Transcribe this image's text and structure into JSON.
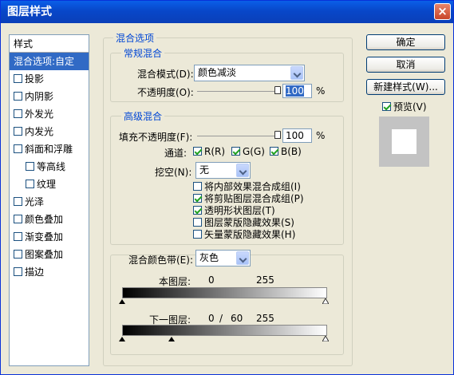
{
  "window": {
    "title": "图层样式",
    "close_glyph": "×"
  },
  "styles": {
    "header": "样式",
    "items": [
      {
        "label": "混合选项:自定",
        "checkbox": false,
        "selected": true
      },
      {
        "label": "投影",
        "checkbox": true
      },
      {
        "label": "内阴影",
        "checkbox": true
      },
      {
        "label": "外发光",
        "checkbox": true
      },
      {
        "label": "内发光",
        "checkbox": true
      },
      {
        "label": "斜面和浮雕",
        "checkbox": true
      },
      {
        "label": "等高线",
        "checkbox": true,
        "sub": true
      },
      {
        "label": "纹理",
        "checkbox": true,
        "sub": true
      },
      {
        "label": "光泽",
        "checkbox": true
      },
      {
        "label": "颜色叠加",
        "checkbox": true
      },
      {
        "label": "渐变叠加",
        "checkbox": true
      },
      {
        "label": "图案叠加",
        "checkbox": true
      },
      {
        "label": "描边",
        "checkbox": true
      }
    ]
  },
  "blend_options": {
    "title": "混合选项",
    "general": {
      "title": "常规混合",
      "mode_label": "混合模式(D):",
      "mode_value": "颜色减淡",
      "opacity_label": "不透明度(O):",
      "opacity_value": "100",
      "percent": "%",
      "opacity_fraction": 1.0
    },
    "advanced": {
      "title": "高级混合",
      "fill_label": "填充不透明度(F):",
      "fill_value": "100",
      "percent": "%",
      "fill_fraction": 1.0,
      "channels_label": "通道:",
      "channel_r": "R(R)",
      "channel_g": "G(G)",
      "channel_b": "B(B)",
      "knockout_label": "挖空(N):",
      "knockout_value": "无",
      "options": [
        {
          "label": "将内部效果混合成组(I)",
          "checked": false
        },
        {
          "label": "将剪贴图层混合成组(P)",
          "checked": true
        },
        {
          "label": "透明形状图层(T)",
          "checked": true
        },
        {
          "label": "图层蒙版隐藏效果(S)",
          "checked": false
        },
        {
          "label": "矢量蒙版隐藏效果(H)",
          "checked": false
        }
      ]
    },
    "blend_if": {
      "label": "混合颜色带(E):",
      "value": "灰色",
      "this_layer_label": "本图层:",
      "this_layer_low": "0",
      "this_layer_high": "255",
      "underlying_label": "下一图层:",
      "underlying_low": "0",
      "underlying_sep": "/",
      "underlying_mid": "60",
      "underlying_high": "255"
    }
  },
  "buttons": {
    "ok": "确定",
    "cancel": "取消",
    "new_style": "新建样式(W)...",
    "preview_label": "预览(V)"
  }
}
